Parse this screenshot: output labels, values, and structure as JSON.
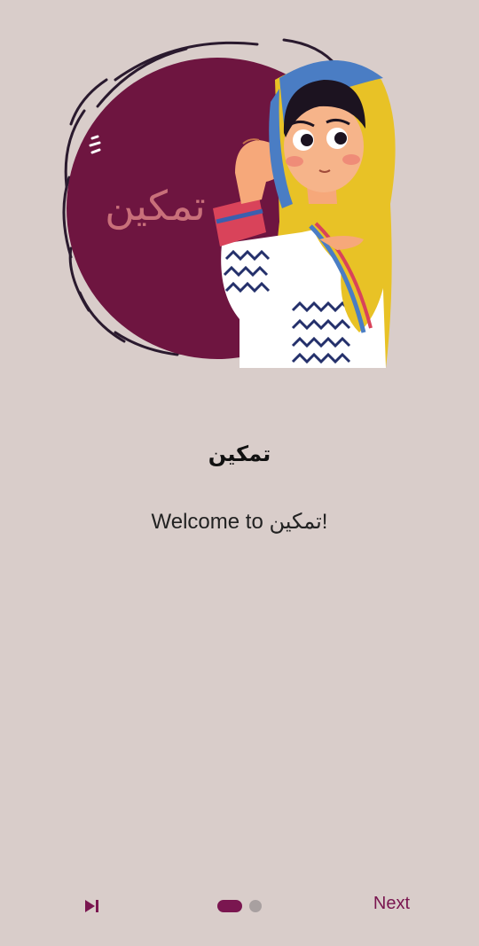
{
  "onboarding": {
    "logo_text": "تمكين",
    "title": "تمكين",
    "subtitle": "Welcome to تمكين!"
  },
  "navigation": {
    "skip_icon": "skip-next-icon",
    "next_label": "Next",
    "page_indicator": {
      "current": 1,
      "total": 2
    }
  },
  "colors": {
    "background": "#d9cdca",
    "accent": "#7a1650",
    "circle": "#6e1540",
    "logo_text": "#c9707a",
    "dot_inactive": "#a8a0a0"
  }
}
